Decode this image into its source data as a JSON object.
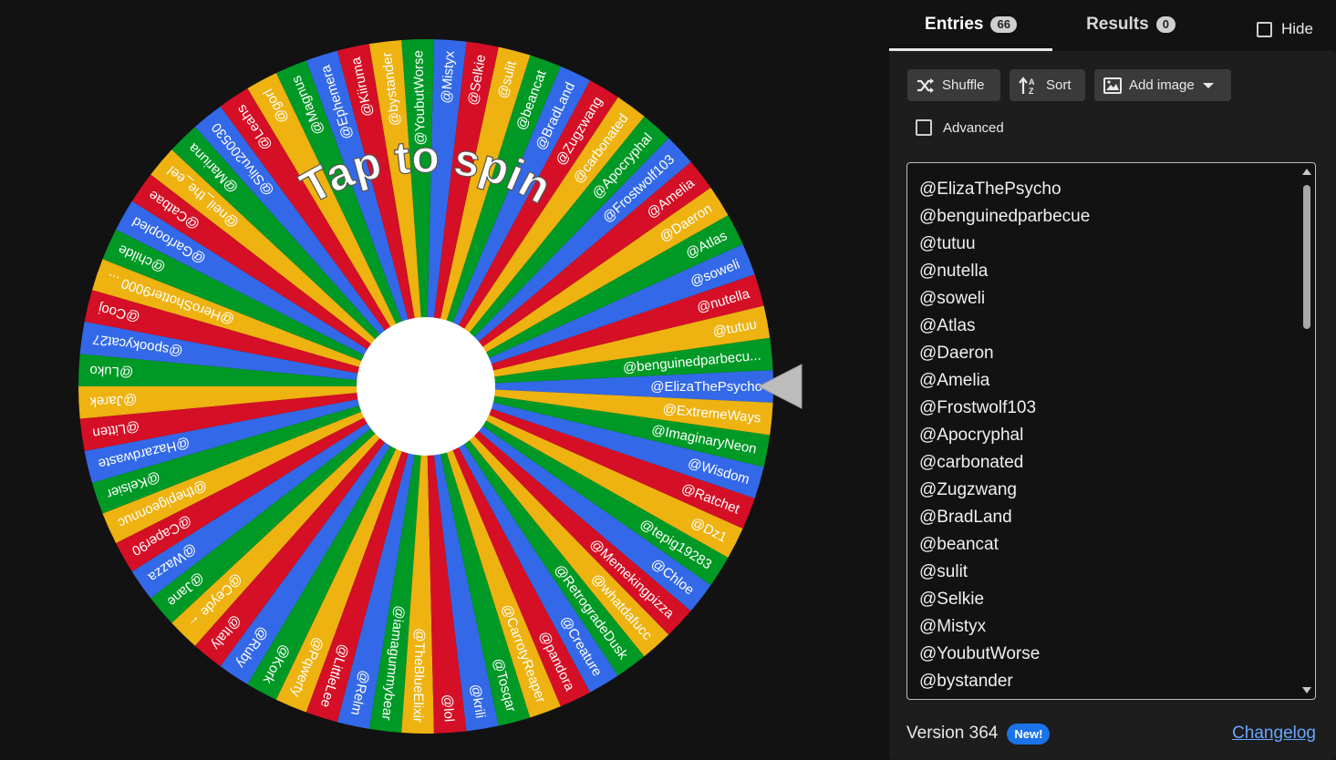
{
  "wheel": {
    "prompt": "Tap to spin",
    "colors": [
      "#3369e8",
      "#009925",
      "#eeb211",
      "#d50f25"
    ],
    "segments": [
      "@ElizaThePsycho",
      "@benguinedparbecu...",
      "@tutuu",
      "@nutella",
      "@soweli",
      "@Atlas",
      "@Daeron",
      "@Amelia",
      "@Frostwolf103",
      "@Apocryphal",
      "@carbonated",
      "@Zugzwang",
      "@BradLand",
      "@beancat",
      "@sulit",
      "@Selkie",
      "@Mistyx",
      "@YoubutWorse",
      "@bystander",
      "@Kiiruma",
      "@Ephemera",
      "@Magnus",
      "@gorl",
      "@Leahs",
      "@Slivu200530",
      "@Mariuna",
      "@neil_the_eel",
      "@Catbae",
      "@Garfoopled",
      "@childe",
      "@HeroShotter9000 ...",
      "@Cooj",
      "@spookycat27",
      "@Luko",
      "@Jarek",
      "@Litten",
      "@Hazardwaste",
      "@Kelsier",
      "@thepigeonnuc",
      "@Caper90",
      "@Wazza",
      "@Jane",
      "@Ceyde ←",
      "@Italy",
      "@Ruby",
      "@Kork",
      "@Pqwerty",
      "@LittleLee",
      "@Relm",
      "@iamagummybear",
      "@TheBlueElixir",
      "@lol",
      "@krili",
      "@Tosqar",
      "@CarrotyReaper",
      "@pandora",
      "@Creature",
      "@RetrogradeDusk",
      "@whatdafucc",
      "@Memekingpizza",
      "@Chloe",
      "@tepig19283",
      "@Dz1",
      "@Ratchet",
      "@Wisdom",
      "@ImaginaryNeon",
      "@ExtremeWays"
    ]
  },
  "panel": {
    "tabs": {
      "entries_label": "Entries",
      "entries_count": "66",
      "results_label": "Results",
      "results_count": "0"
    },
    "hide_label": "Hide",
    "buttons": {
      "shuffle": "Shuffle",
      "sort": "Sort",
      "add_image": "Add image"
    },
    "advanced_label": "Advanced",
    "entries": [
      "@ElizaThePsycho",
      "@benguinedparbecue",
      "@tutuu",
      "@nutella",
      "@soweli",
      "@Atlas",
      "@Daeron",
      "@Amelia",
      "@Frostwolf103",
      "@Apocryphal",
      "@carbonated",
      "@Zugzwang",
      "@BradLand",
      "@beancat",
      "@sulit",
      "@Selkie",
      "@Mistyx",
      "@YoubutWorse",
      "@bystander"
    ],
    "version": "Version 364",
    "new_badge": "New!",
    "changelog": "Changelog"
  }
}
